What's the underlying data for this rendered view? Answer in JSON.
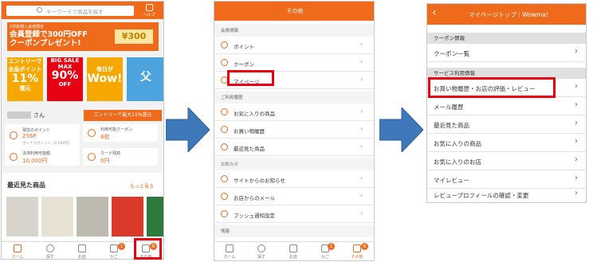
{
  "panel1": {
    "search_placeholder": "キーワードで商品を探す",
    "help_label": "ヘルプ",
    "banner_small": "5月新規入会者限定",
    "banner_main_1": "会員登録で300円OFF",
    "banner_main_2": "クーポンプレゼント!",
    "banner_coupon": "¥300",
    "promos": [
      {
        "top": "エントリーで",
        "mid": "全品ポイント",
        "big": "11%",
        "bot": "還元",
        "color": "#f7a800"
      },
      {
        "top": "BIG SALE",
        "mid": "MAX",
        "big": "90%",
        "bot": "OFF",
        "color": "#e60012"
      },
      {
        "top": "毎日が",
        "mid": "",
        "big": "Wow!",
        "bot": "",
        "color": "#f7a800"
      },
      {
        "top": "",
        "mid": "",
        "big": "父",
        "bot": "",
        "color": "#4ca3dd"
      }
    ],
    "user_suffix": "さん",
    "entry_button": "エントリーで最大11%還元",
    "points_label": "現在のポイント",
    "points_value": "256P",
    "points_sub": "ボーナスポイント（2,000円）",
    "coupon_label": "利用可能クーポン",
    "coupon_value": "8枚",
    "payment_label": "決済利用可能額",
    "payment_value": "10,000円",
    "card_label": "カード残高",
    "card_value": "0円",
    "recent_title": "最近見た商品",
    "more_link": "もっと見る",
    "tabs": [
      "ホーム",
      "探す",
      "お店",
      "かご",
      "その他"
    ],
    "cart_badge": "1",
    "other_badge": "6"
  },
  "panel2": {
    "header": "その他",
    "sections": [
      {
        "title": "会員情報",
        "items": [
          "ポイント",
          "クーポン",
          "マイページ"
        ]
      },
      {
        "title": "ご利用履歴",
        "items": [
          "お気に入りの商品",
          "お買い物履歴",
          "最近見た商品"
        ]
      },
      {
        "title": "お知らせ",
        "items": [
          "サイトからのお知らせ",
          "お店からのメール",
          "プッシュ通知設定"
        ]
      },
      {
        "title": "情報",
        "items": []
      }
    ],
    "tabs": [
      "ホーム",
      "探す",
      "お店",
      "かご",
      "その他"
    ],
    "cart_badge": "1",
    "other_badge": "6"
  },
  "panel3": {
    "back_icon": "‹",
    "header": "マイページトップ｜Wowma!",
    "sections": [
      {
        "title": "クーポン情報",
        "items": [
          "クーポン一覧"
        ]
      },
      {
        "title": "サービス利用情報",
        "items": [
          "お買い物履歴・お店の評価・レビュー",
          "メール履歴",
          "最近見た商品",
          "お気に入りの商品",
          "お気に入りのお店",
          "マイレビュー",
          "レビュープロフィールの確認・変更"
        ]
      }
    ]
  },
  "colors": {
    "accent": "#f06a1b",
    "highlight": "#e60012",
    "arrow": "#3f78b8"
  }
}
